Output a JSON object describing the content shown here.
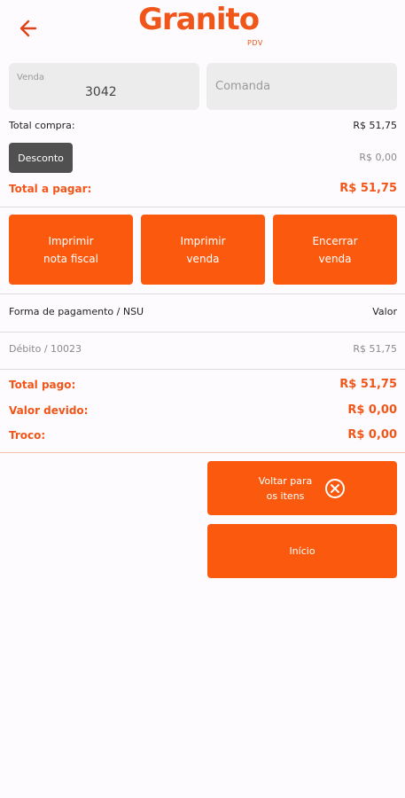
{
  "brand": {
    "name": "Granito",
    "sub": "PDV",
    "color": "#f0561a"
  },
  "header": {
    "back_icon": "arrow-left-icon"
  },
  "fields": {
    "venda": {
      "label": "Venda",
      "value": "3042"
    },
    "comanda": {
      "placeholder": "Comanda"
    }
  },
  "summary": {
    "total_compra_label": "Total compra:",
    "total_compra_value": "R$ 51,75",
    "desconto_label": "Desconto",
    "desconto_value": "R$ 0,00",
    "total_pagar_label": "Total a pagar:",
    "total_pagar_value": "R$ 51,75"
  },
  "actions": {
    "imprimir_nota": [
      "Imprimir",
      "nota fiscal"
    ],
    "imprimir_venda": [
      "Imprimir",
      "venda"
    ],
    "encerrar_venda": [
      "Encerrar",
      "venda"
    ]
  },
  "payments": {
    "header_left": "Forma de pagamento / NSU",
    "header_right": "Valor",
    "rows": [
      {
        "method": "Débito / 10023",
        "value": "R$ 51,75"
      }
    ]
  },
  "totals": {
    "total_pago_label": "Total pago:",
    "total_pago_value": "R$ 51,75",
    "valor_devido_label": "Valor devido:",
    "valor_devido_value": "R$ 0,00",
    "troco_label": "Troco:",
    "troco_value": "R$ 0,00"
  },
  "footer": {
    "voltar": [
      "Voltar para",
      "os itens"
    ],
    "voltar_icon": "close-circle-icon",
    "inicio": "Início"
  }
}
